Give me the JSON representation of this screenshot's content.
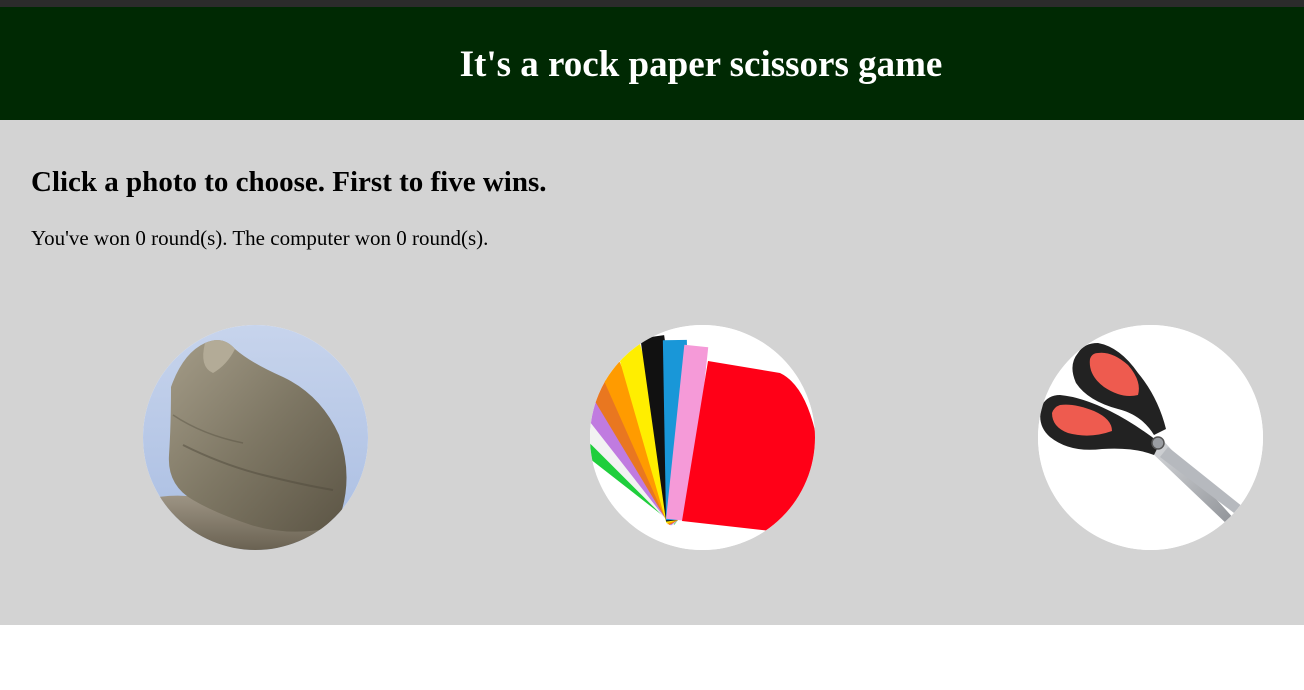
{
  "header": {
    "title": "It's a rock paper scissors game"
  },
  "main": {
    "instructions": "Click a photo to choose. First to five wins.",
    "score": {
      "player_wins": 0,
      "computer_wins": 0,
      "text": "You've won 0 round(s). The computer won 0 round(s)."
    }
  },
  "choices": [
    {
      "id": "rock",
      "icon": "rock-photo"
    },
    {
      "id": "paper",
      "icon": "paper-photo"
    },
    {
      "id": "scissors",
      "icon": "scissors-photo"
    }
  ],
  "colors": {
    "header_bg": "#002903",
    "main_bg": "#d3d3d3",
    "top_strip": "#2b2b2b"
  }
}
